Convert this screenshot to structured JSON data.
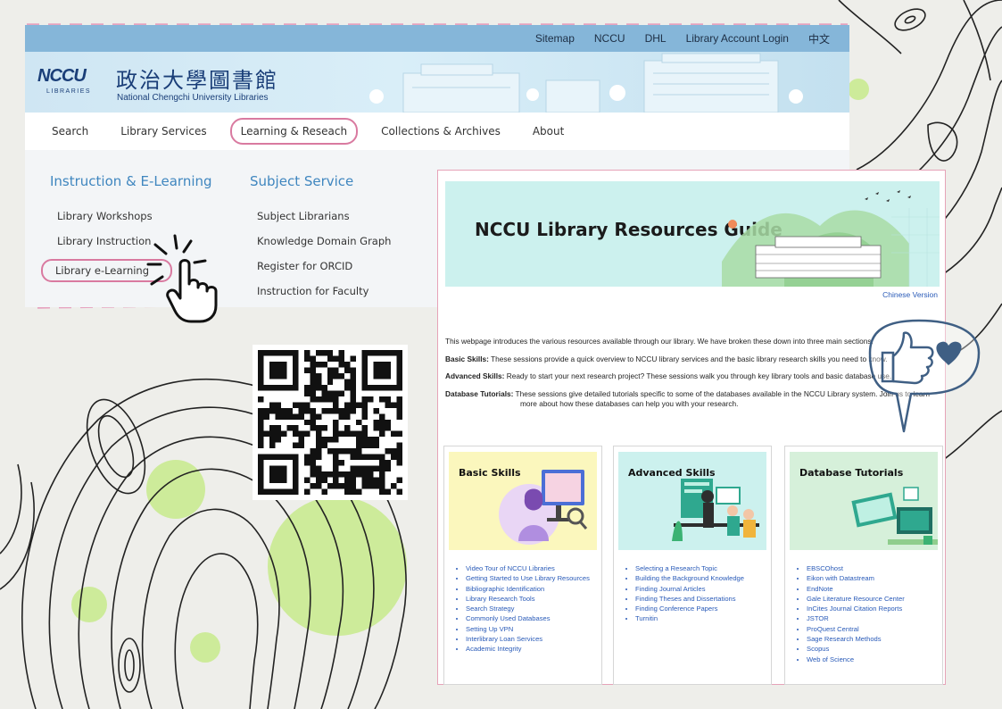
{
  "site": {
    "topnav": [
      "Sitemap",
      "NCCU",
      "DHL",
      "Library Account Login",
      "中文"
    ],
    "logo": {
      "mark": "NCCU",
      "sub": "LIBRARIES",
      "zh": "政治大學圖書館",
      "en": "National Chengchi University Libraries"
    },
    "mainnav": [
      "Search",
      "Library Services",
      "Learning & Reseach",
      "Collections & Archives",
      "About"
    ],
    "mainnav_active_index": 2,
    "dropdown": {
      "col1": {
        "heading": "Instruction & E-Learning",
        "links": [
          "Library Workshops",
          "Library Instruction",
          "Library e-Learning"
        ],
        "highlight_index": 2
      },
      "col2": {
        "heading": "Subject Service",
        "links": [
          "Subject Librarians",
          "Knowledge Domain Graph",
          "Register for ORCID",
          "Instruction for Faculty"
        ]
      }
    }
  },
  "guide": {
    "title": "NCCU Library Resources Guide",
    "chinese_version": "Chinese Version",
    "intro": "This webpage introduces the various resources available through our library. We have broken these down into three main sections:",
    "sections": [
      {
        "label": "Basic Skills:",
        "text": " These sessions provide a quick overview to NCCU library services and the basic library research skills you need to know."
      },
      {
        "label": "Advanced Skills:",
        "text": " Ready to start your next research project? These sessions walk you through key library tools and basic database use."
      },
      {
        "label": "Database Tutorials:",
        "text": " These sessions give detailed tutorials specific to some of the databases available in the NCCU Library system. Join us to learn",
        "text2": "more about how these databases can help you with your research."
      }
    ],
    "cards": [
      {
        "title": "Basic Skills",
        "bg": "#fbf7bd",
        "links": [
          "Video Tour of NCCU Libraries",
          "Getting Started to Use Library Resources",
          "Bibliographic Identification",
          "Library Research Tools",
          "Search Strategy",
          "Commonly Used Databases",
          "Setting Up VPN",
          "Interlibrary Loan Services",
          "Academic Integrity"
        ]
      },
      {
        "title": "Advanced Skills",
        "bg": "#ccf1ee",
        "links": [
          "Selecting a Research Topic",
          "Building the Background Knowledge",
          "Finding Journal Articles",
          "Finding Theses and Dissertations",
          "Finding Conference Papers",
          "Turnitin"
        ]
      },
      {
        "title": "Database Tutorials",
        "bg": "#d6f0da",
        "links": [
          "EBSCOhost",
          "Eikon with Datastream",
          "EndNote",
          "Gale Literature Resource Center",
          "InCites Journal Citation Reports",
          "JSTOR",
          "ProQuest Central",
          "Sage Research Methods",
          "Scopus",
          "Web of Science"
        ]
      }
    ]
  },
  "colors": {
    "topbar": "#85b6d9",
    "accent_pink": "#d97aa0",
    "heading_blue": "#3f86bf",
    "link_blue": "#2a5bb8",
    "blob_green": "#cdeb9a"
  }
}
